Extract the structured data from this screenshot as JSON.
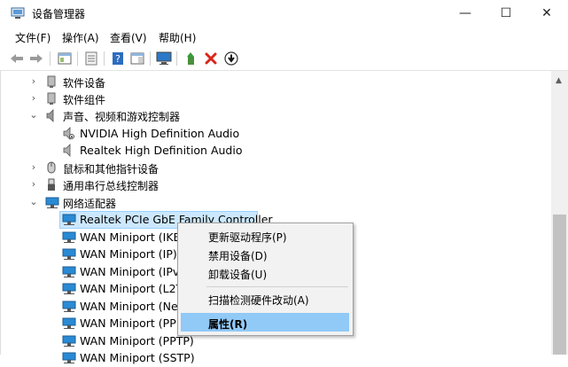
{
  "window": {
    "title": "设备管理器",
    "min_glyph": "—",
    "max_glyph": "☐",
    "close_glyph": "✕"
  },
  "menu": [
    "文件(F)",
    "操作(A)",
    "查看(V)",
    "帮助(H)"
  ],
  "toolbar": {
    "buttons": [
      "back-icon",
      "forward-icon",
      "show-hide-tree-icon",
      "properties-icon",
      "help-icon",
      "action-pane-icon",
      "monitor-icon",
      "update-driver-icon",
      "uninstall-icon",
      "disable-icon"
    ]
  },
  "tree": {
    "items": [
      {
        "label": "软件设备",
        "chevron": "›",
        "icon": "software-device-icon"
      },
      {
        "label": "软件组件",
        "chevron": "›",
        "icon": "software-component-icon"
      },
      {
        "label": "声音、视频和游戏控制器",
        "chevron": "⌄",
        "icon": "speaker-icon"
      },
      {
        "label": "NVIDIA High Definition Audio",
        "icon": "audio-device-icon"
      },
      {
        "label": "Realtek High Definition Audio",
        "icon": "audio-device-icon"
      },
      {
        "label": "鼠标和其他指针设备",
        "chevron": "›",
        "icon": "mouse-icon"
      },
      {
        "label": "通用串行总线控制器",
        "chevron": "›",
        "icon": "usb-icon"
      },
      {
        "label": "网络适配器",
        "chevron": "⌄",
        "icon": "network-icon"
      },
      {
        "label": "Realtek PCIe GbE Family Controller",
        "icon": "network-adapter-icon",
        "selected": true
      },
      {
        "label": "WAN Miniport (IKEv2)",
        "icon": "network-adapter-icon"
      },
      {
        "label": "WAN Miniport (IP)",
        "icon": "network-adapter-icon"
      },
      {
        "label": "WAN Miniport (IPv6)",
        "icon": "network-adapter-icon"
      },
      {
        "label": "WAN Miniport (L2TP)",
        "icon": "network-adapter-icon"
      },
      {
        "label": "WAN Miniport (Network Monitor)",
        "icon": "network-adapter-icon"
      },
      {
        "label": "WAN Miniport (PPPOE)",
        "icon": "network-adapter-icon"
      },
      {
        "label": "WAN Miniport (PPTP)",
        "icon": "network-adapter-icon"
      },
      {
        "label": "WAN Miniport (SSTP)",
        "icon": "network-adapter-icon"
      }
    ]
  },
  "context_menu": {
    "items": [
      "更新驱动程序(P)",
      "禁用设备(D)",
      "卸载设备(U)",
      "扫描检测硬件改动(A)",
      "属性(R)"
    ],
    "highlighted": "属性(R)"
  },
  "colors": {
    "selection": "#cce8ff",
    "menu_highlight": "#91c9f7",
    "network_blue": "#2a8ad4",
    "delete_red": "#d9241b"
  }
}
